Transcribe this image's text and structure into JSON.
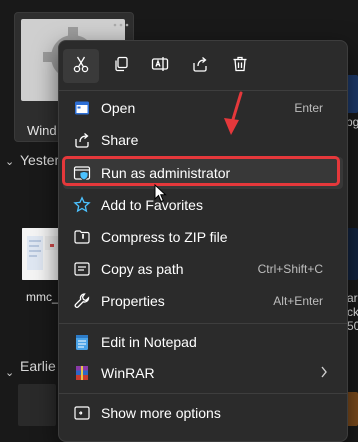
{
  "background": {
    "selected_file_label": "Wind",
    "group_yesterday": "Yester",
    "group_earlier": "Earlie",
    "file_label_mmc": "mmc_",
    "right_fragment_1": "pg",
    "right_fragment_2": "ar",
    "right_fragment_3": "ck",
    "right_fragment_4": "50-"
  },
  "menu": {
    "quick_actions": [
      {
        "name": "cut",
        "icon": "scissors-icon"
      },
      {
        "name": "copy",
        "icon": "copy-icon"
      },
      {
        "name": "rename",
        "icon": "rename-icon"
      },
      {
        "name": "share",
        "icon": "share-icon"
      },
      {
        "name": "delete",
        "icon": "trash-icon"
      }
    ],
    "items": [
      {
        "label": "Open",
        "shortcut": "Enter",
        "icon": "app-window-icon"
      },
      {
        "label": "Share",
        "shortcut": "",
        "icon": "share-icon"
      },
      {
        "label": "Run as administrator",
        "shortcut": "",
        "icon": "shield-icon"
      },
      {
        "label": "Add to Favorites",
        "shortcut": "",
        "icon": "star-icon"
      },
      {
        "label": "Compress to ZIP file",
        "shortcut": "",
        "icon": "zip-folder-icon"
      },
      {
        "label": "Copy as path",
        "shortcut": "Ctrl+Shift+C",
        "icon": "copy-path-icon"
      },
      {
        "label": "Properties",
        "shortcut": "Alt+Enter",
        "icon": "wrench-icon"
      },
      {
        "label": "Edit in Notepad",
        "shortcut": "",
        "icon": "notepad-icon"
      },
      {
        "label": "WinRAR",
        "shortcut": "",
        "icon": "winrar-icon"
      },
      {
        "label": "Show more options",
        "shortcut": "",
        "icon": "more-options-icon"
      }
    ]
  },
  "colors": {
    "menu_bg": "#2b2b2b",
    "accent_blue": "#4cc2ff",
    "annotation_red": "#e5383b"
  }
}
